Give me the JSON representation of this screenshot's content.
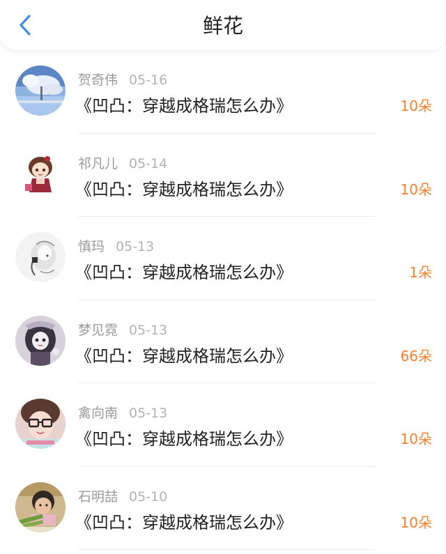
{
  "header": {
    "title": "鲜花",
    "back_icon": "chevron-left-icon",
    "accent_color": "#3a8ee6"
  },
  "colors": {
    "count": "#ff7f2a",
    "name": "#999999"
  },
  "gifts": [
    {
      "name": "贺奇伟",
      "date": "05-16",
      "book": "《凹凸：穿越成格瑞怎么办》",
      "count": "10朵",
      "avatar": "winter-tree-avatar"
    },
    {
      "name": "祁凡儿",
      "date": "05-14",
      "book": "《凹凸：穿越成格瑞怎么办》",
      "count": "10朵",
      "avatar": "anime-girl-avatar"
    },
    {
      "name": "慎玛",
      "date": "05-13",
      "book": "《凹凸：穿越成格瑞怎么办》",
      "count": "1朵",
      "avatar": "sketch-avatar"
    },
    {
      "name": "梦见霓",
      "date": "05-13",
      "book": "《凹凸：穿越成格瑞怎么办》",
      "count": "66朵",
      "avatar": "gothic-doll-avatar"
    },
    {
      "name": "禽向南",
      "date": "05-13",
      "book": "《凹凸：穿越成格瑞怎么办》",
      "count": "10朵",
      "avatar": "glasses-girl-avatar"
    },
    {
      "name": "石明喆",
      "date": "05-10",
      "book": "《凹凸：穿越成格瑞怎么办》",
      "count": "10朵",
      "avatar": "child-photo-avatar"
    }
  ]
}
